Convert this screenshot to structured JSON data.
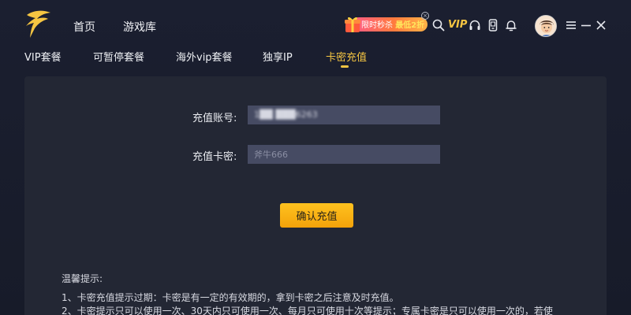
{
  "topnav": {
    "home": "首页",
    "library": "游戏库"
  },
  "promo": {
    "text_prefix": "限时秒杀",
    "text_highlight": "最低2折"
  },
  "toolbar": {
    "vip": "VIP"
  },
  "subnav": {
    "items": [
      "VIP套餐",
      "可暂停套餐",
      "海外vip套餐",
      "独享IP",
      "卡密充值"
    ],
    "active_index": 4
  },
  "form": {
    "account_label": "充值账号:",
    "account_value": "1██ ███6263",
    "card_label": "充值卡密:",
    "card_placeholder": "斧牛666",
    "confirm_button": "确认充值"
  },
  "tips": {
    "title": "温馨提示:",
    "lines": [
      "1、卡密充值提示过期：卡密是有一定的有效期的，拿到卡密之后注意及时充值。",
      "2、卡密提示只可以使用一次、30天内只可使用一次、每月只可使用十次等提示；专属卡密是只可以使用一次的，若使"
    ]
  },
  "colors": {
    "accent": "#f5c542",
    "background": "#181c2b",
    "panel": "#232734",
    "input": "#464b63",
    "button": "#ffb515"
  },
  "icons": [
    "logo-icon",
    "gift-icon",
    "search-icon",
    "vip-icon",
    "headset-icon",
    "phone-icon",
    "bell-icon",
    "menu-icon",
    "minimize-icon",
    "close-icon"
  ]
}
